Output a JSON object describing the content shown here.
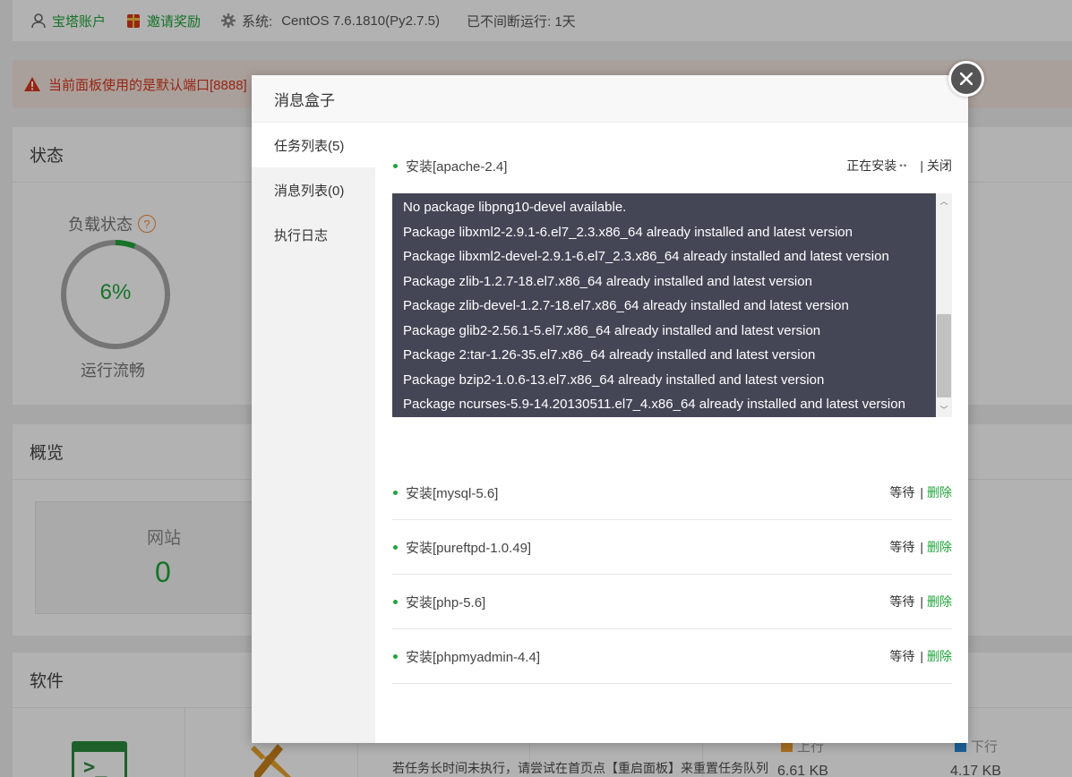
{
  "topbar": {
    "account_label": "宝塔账户",
    "invite_label": "邀请奖励",
    "system_label": "系统:",
    "system_value": "CentOS 7.6.1810(Py2.7.5)",
    "uptime_label": "已不间断运行: 1天"
  },
  "alert": {
    "text": "当前面板使用的是默认端口[8888]"
  },
  "status_panel": {
    "title": "状态",
    "load_title": "负载状态",
    "load_value": "6%",
    "load_fraction": 0.06,
    "load_sub": "运行流畅"
  },
  "overview_panel": {
    "title": "概览",
    "site_label": "网站",
    "site_count": "0"
  },
  "software_panel": {
    "title": "软件",
    "up_label": "上行",
    "down_label": "下行",
    "up_value": "6.61 KB",
    "down_value": "4.17 KB"
  },
  "modal": {
    "title": "消息盒子",
    "tabs": [
      {
        "label": "任务列表(5)",
        "active": true
      },
      {
        "label": "消息列表(0)",
        "active": false
      },
      {
        "label": "执行日志",
        "active": false
      }
    ],
    "current_task": {
      "name": "安装[apache-2.4]",
      "status": "正在安装",
      "close_label": "关闭"
    },
    "console_lines": [
      "No package libpng10-devel available.",
      "Package libxml2-2.9.1-6.el7_2.3.x86_64 already installed and latest version",
      "Package libxml2-devel-2.9.1-6.el7_2.3.x86_64 already installed and latest version",
      "Package zlib-1.2.7-18.el7.x86_64 already installed and latest version",
      "Package zlib-devel-1.2.7-18.el7.x86_64 already installed and latest version",
      "Package glib2-2.56.1-5.el7.x86_64 already installed and latest version",
      "Package 2:tar-1.26-35.el7.x86_64 already installed and latest version",
      "Package bzip2-1.0.6-13.el7.x86_64 already installed and latest version",
      "Package ncurses-5.9-14.20130511.el7_4.x86_64 already installed and latest version"
    ],
    "queued_tasks": [
      {
        "name": "安装[mysql-5.6]",
        "status": "等待",
        "action": "删除"
      },
      {
        "name": "安装[pureftpd-1.0.49]",
        "status": "等待",
        "action": "删除"
      },
      {
        "name": "安装[php-5.6]",
        "status": "等待",
        "action": "删除"
      },
      {
        "name": "安装[phpmyadmin-4.4]",
        "status": "等待",
        "action": "删除"
      }
    ],
    "footnote": "若任务长时间未执行，请尝试在首页点【重启面板】来重置任务队列"
  },
  "colors": {
    "accent_green": "#20a53a",
    "alert_red": "#d9361c",
    "console_bg": "#444656"
  }
}
